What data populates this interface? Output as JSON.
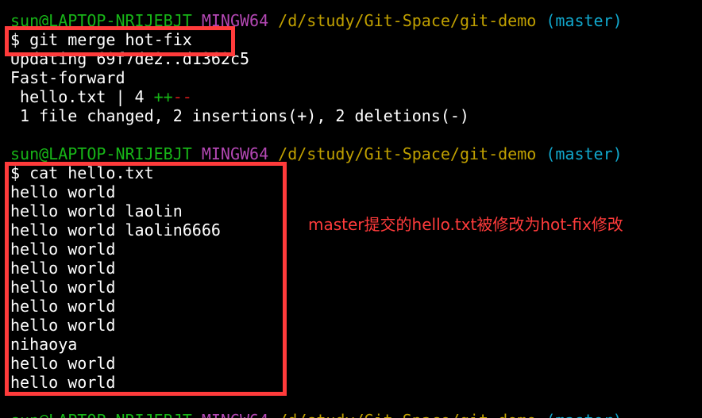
{
  "terminal": {
    "prompt": {
      "user_host": "sun@LAPTOP-NRIJEBJT",
      "env": "MINGW64",
      "path": "/d/study/Git-Space/git-demo",
      "branch": "(master)"
    },
    "merge": {
      "command": "$ git merge hot-fix",
      "updating": "Updating 69f7de2..d1362c5",
      "fast_forward": "Fast-forward",
      "stat_file": " hello.txt | 4 ",
      "stat_plus": "++",
      "stat_minus": "--",
      "summary": " 1 file changed, 2 insertions(+), 2 deletions(-)"
    },
    "cat": {
      "command": "$ cat hello.txt",
      "output": [
        "hello world",
        "hello world laolin",
        "hello world laolin6666",
        "hello world",
        "hello world",
        "hello world",
        "hello world",
        "hello world",
        "nihaoya",
        "hello world",
        "hello world"
      ]
    }
  },
  "annotation": {
    "text": "master提交的hello.txt被修改为hot-fix修改"
  },
  "colors": {
    "background": "#000000",
    "highlight_box": "#ff3b3b",
    "user_host": "#17b417",
    "env": "#b347b3",
    "path": "#c0a000",
    "branch": "#11a8cd"
  }
}
